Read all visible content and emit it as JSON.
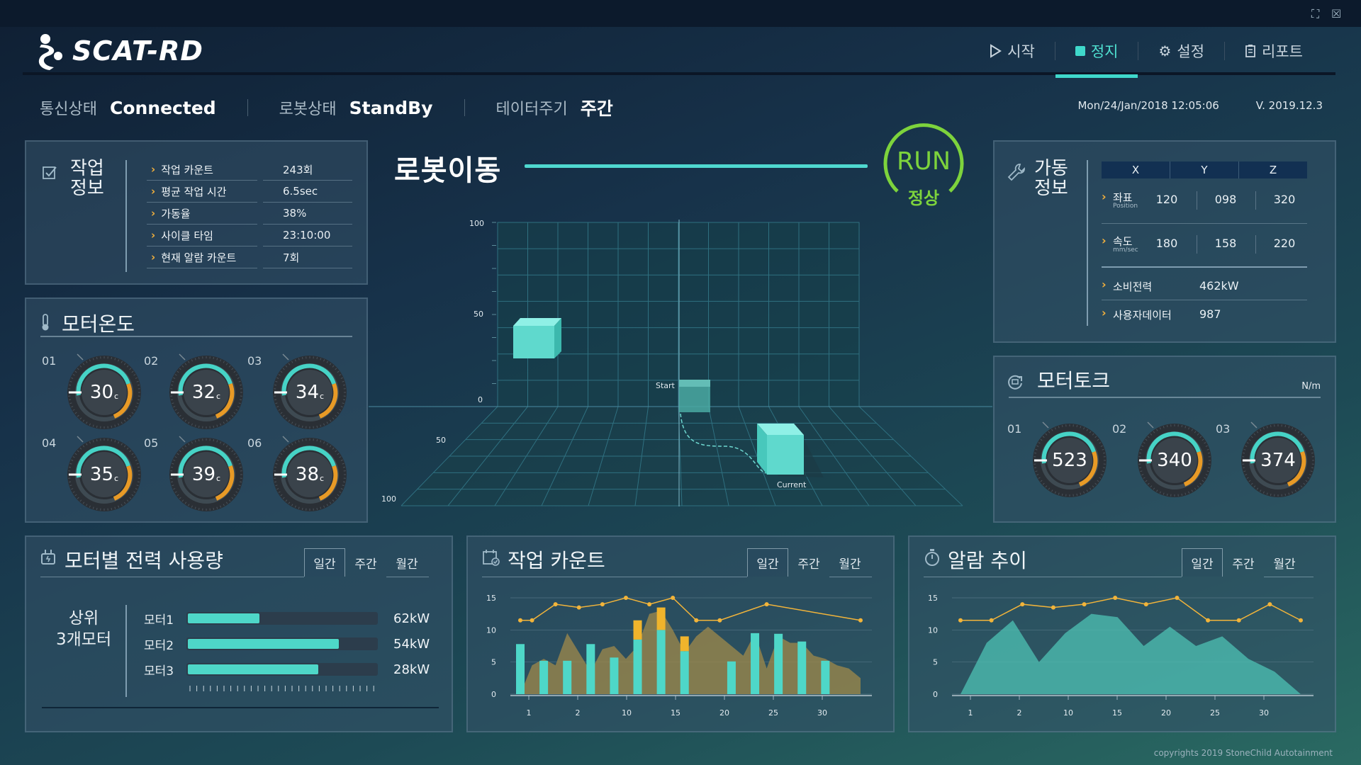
{
  "window": {
    "maximize_icon": "maximize-icon",
    "close_icon": "close-icon"
  },
  "app": {
    "title": "SCAT-RD"
  },
  "nav": [
    {
      "label": "시작",
      "icon": "play-icon"
    },
    {
      "label": "정지",
      "icon": "stop-icon",
      "active": true
    },
    {
      "label": "설정",
      "icon": "gear-icon"
    },
    {
      "label": "리포트",
      "icon": "report-icon"
    }
  ],
  "status": {
    "comm_label": "통신상태",
    "comm_value": "Connected",
    "robot_label": "로봇상태",
    "robot_value": "StandBy",
    "cycle_label": "테이터주기",
    "cycle_value": "주간",
    "datetime": "Mon/24/Jan/2018 12:05:06",
    "version": "V. 2019.12.3"
  },
  "work_info": {
    "title_line1": "작업",
    "title_line2": "정보",
    "rows": [
      {
        "key": "작업 카운트",
        "value": "243회"
      },
      {
        "key": "평균 작업 시간",
        "value": "6.5sec"
      },
      {
        "key": "가동율",
        "value": "38%"
      },
      {
        "key": "사이클 타임",
        "value": "23:10:00"
      },
      {
        "key": "현재 알람 카운트",
        "value": "7회"
      }
    ]
  },
  "motor_temp": {
    "title": "모터온도",
    "unit": "°C",
    "gauges": [
      {
        "index": "01",
        "value": "30"
      },
      {
        "index": "02",
        "value": "32"
      },
      {
        "index": "03",
        "value": "34"
      },
      {
        "index": "04",
        "value": "35"
      },
      {
        "index": "05",
        "value": "39"
      },
      {
        "index": "06",
        "value": "38"
      }
    ]
  },
  "robot": {
    "title": "로봇이동",
    "run_label": "RUN",
    "run_status": "정상",
    "y_ticks": [
      "100",
      "50",
      "0"
    ],
    "z_ticks": [
      "50",
      "100"
    ],
    "start_label": "Start",
    "current_label": "Current"
  },
  "op_info": {
    "title_line1": "가동",
    "title_line2": "정보",
    "columns": [
      "X",
      "Y",
      "Z"
    ],
    "rows": [
      {
        "label": "좌표",
        "sub": "Position",
        "values": [
          "120",
          "098",
          "320"
        ]
      },
      {
        "label": "속도",
        "sub": "mm/sec",
        "values": [
          "180",
          "158",
          "220"
        ]
      }
    ],
    "extra": [
      {
        "label": "소비전력",
        "value": "462kW"
      },
      {
        "label": "사용자데이터",
        "value": "987"
      }
    ]
  },
  "motor_torque": {
    "title": "모터토크",
    "unit": "N/m",
    "gauges": [
      {
        "index": "01",
        "value": "523"
      },
      {
        "index": "02",
        "value": "340"
      },
      {
        "index": "03",
        "value": "374"
      }
    ]
  },
  "power_usage": {
    "title": "모터별 전력 사용량",
    "tabs": [
      "일간",
      "주간",
      "월간"
    ],
    "side_label_line1": "상위",
    "side_label_line2": "3개모터",
    "bars": [
      {
        "label": "모터1",
        "fraction": 0.38,
        "value": "62kW"
      },
      {
        "label": "모터2",
        "fraction": 0.8,
        "value": "54kW"
      },
      {
        "label": "모터3",
        "fraction": 0.69,
        "value": "28kW"
      }
    ]
  },
  "work_count_chart": {
    "title": "작업 카운트",
    "tabs": [
      "일간",
      "주간",
      "월간"
    ],
    "y_ticks": [
      "15",
      "10",
      "5",
      "0"
    ],
    "x_ticks": [
      "1",
      "2",
      "10",
      "15",
      "20",
      "25",
      "30"
    ]
  },
  "alarm_chart": {
    "title": "알람 추이",
    "tabs": [
      "일간",
      "주간",
      "월간"
    ],
    "y_ticks": [
      "15",
      "10",
      "5",
      "0"
    ],
    "x_ticks": [
      "1",
      "2",
      "10",
      "15",
      "20",
      "25",
      "30"
    ]
  },
  "chart_data": [
    {
      "type": "bar",
      "title": "작업 카운트",
      "ylim": [
        0,
        15
      ],
      "x": [
        "1",
        "2",
        "3",
        "4",
        "5",
        "6",
        "7",
        "8",
        "9",
        "10",
        "11",
        "12",
        "13",
        "14",
        "15",
        "16",
        "17",
        "18",
        "19",
        "20",
        "21",
        "22",
        "23",
        "24",
        "25",
        "26",
        "27",
        "28",
        "29",
        "30"
      ],
      "series": [
        {
          "values": [
            7.8,
            0,
            5.2,
            0,
            5.2,
            0,
            7.8,
            0,
            5.7,
            0,
            8.5,
            0,
            10,
            0,
            6.7,
            0,
            0,
            0,
            5.1,
            0,
            9.5,
            0,
            9.4,
            0,
            8.2,
            0,
            5.2,
            0,
            0,
            0
          ]
        },
        {
          "values": [
            0,
            0,
            0,
            0,
            0,
            0,
            0,
            0,
            0,
            0,
            3,
            0,
            3.5,
            0,
            2.3,
            0,
            0,
            0,
            0,
            0,
            0,
            0,
            0,
            0,
            0,
            0,
            0,
            0,
            0,
            0
          ]
        },
        {
          "values": [
            0,
            4.5,
            5.5,
            4.5,
            9.5,
            6.5,
            3.5,
            7,
            7.5,
            5.5,
            7.5,
            12.5,
            13,
            10,
            6.5,
            9,
            10.5,
            9,
            7.5,
            6,
            9.5,
            4,
            9,
            8,
            8,
            6,
            5.5,
            4.5,
            4,
            2.5
          ]
        },
        {
          "values": [
            11.5,
            11.5,
            null,
            14,
            null,
            13.5,
            null,
            14,
            null,
            15,
            null,
            14,
            null,
            15,
            null,
            11.5,
            null,
            11.5,
            null,
            null,
            null,
            14,
            null,
            null,
            null,
            null,
            null,
            null,
            null,
            11.5
          ]
        }
      ]
    },
    {
      "type": "area",
      "title": "알람 추이",
      "ylim": [
        0,
        15
      ],
      "x": [
        "1",
        "2",
        "3",
        "4",
        "5",
        "6",
        "7",
        "8",
        "9",
        "10",
        "11",
        "12",
        "13",
        "14",
        "15",
        "16",
        "17",
        "18",
        "19",
        "20"
      ],
      "series": [
        {
          "values": [
            0,
            8,
            11.5,
            5,
            9.5,
            12.5,
            12,
            7.5,
            10.5,
            7.5,
            9,
            5.5,
            3.5,
            0
          ]
        },
        {
          "values": [
            11.5,
            11.5,
            14,
            13.5,
            14,
            15,
            14,
            15,
            11.5,
            11.5,
            14,
            11.5
          ]
        }
      ]
    }
  ]
}
